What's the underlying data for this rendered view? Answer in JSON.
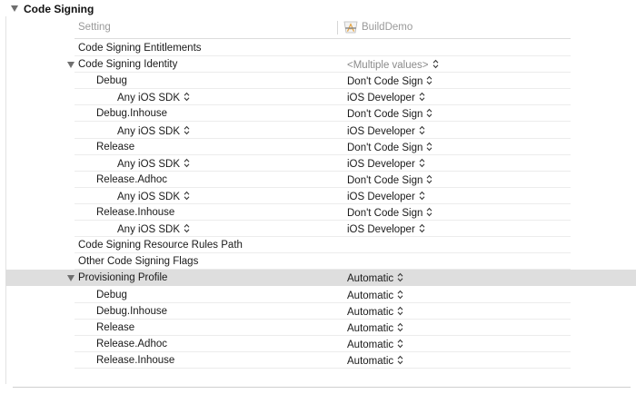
{
  "section": {
    "title": "Code Signing"
  },
  "columns": {
    "setting": "Setting",
    "target": "BuildDemo"
  },
  "rows": [
    {
      "label": "Code Signing Entitlements",
      "indent": 0,
      "expander": false,
      "value": "",
      "stepper": false,
      "muted": false,
      "selected": false
    },
    {
      "label": "Code Signing Identity",
      "indent": 0,
      "expander": true,
      "value": "<Multiple values>",
      "stepper": true,
      "muted": true,
      "selected": false
    },
    {
      "label": "Debug",
      "indent": 1,
      "expander": false,
      "value": "Don't Code Sign",
      "stepper": true,
      "muted": false,
      "selected": false
    },
    {
      "label": "Any iOS SDK",
      "indent": 2,
      "expander": false,
      "labelStepper": true,
      "value": "iOS Developer",
      "stepper": true,
      "muted": false,
      "selected": false
    },
    {
      "label": "Debug.Inhouse",
      "indent": 1,
      "expander": false,
      "value": "Don't Code Sign",
      "stepper": true,
      "muted": false,
      "selected": false
    },
    {
      "label": "Any iOS SDK",
      "indent": 2,
      "expander": false,
      "labelStepper": true,
      "value": "iOS Developer",
      "stepper": true,
      "muted": false,
      "selected": false
    },
    {
      "label": "Release",
      "indent": 1,
      "expander": false,
      "value": "Don't Code Sign",
      "stepper": true,
      "muted": false,
      "selected": false
    },
    {
      "label": "Any iOS SDK",
      "indent": 2,
      "expander": false,
      "labelStepper": true,
      "value": "iOS Developer",
      "stepper": true,
      "muted": false,
      "selected": false
    },
    {
      "label": "Release.Adhoc",
      "indent": 1,
      "expander": false,
      "value": "Don't Code Sign",
      "stepper": true,
      "muted": false,
      "selected": false
    },
    {
      "label": "Any iOS SDK",
      "indent": 2,
      "expander": false,
      "labelStepper": true,
      "value": "iOS Developer",
      "stepper": true,
      "muted": false,
      "selected": false
    },
    {
      "label": "Release.Inhouse",
      "indent": 1,
      "expander": false,
      "value": "Don't Code Sign",
      "stepper": true,
      "muted": false,
      "selected": false
    },
    {
      "label": "Any iOS SDK",
      "indent": 2,
      "expander": false,
      "labelStepper": true,
      "value": "iOS Developer",
      "stepper": true,
      "muted": false,
      "selected": false
    },
    {
      "label": "Code Signing Resource Rules Path",
      "indent": 0,
      "expander": false,
      "value": "",
      "stepper": false,
      "muted": false,
      "selected": false
    },
    {
      "label": "Other Code Signing Flags",
      "indent": 0,
      "expander": false,
      "value": "",
      "stepper": false,
      "muted": false,
      "selected": false
    },
    {
      "label": "Provisioning Profile",
      "indent": 0,
      "expander": true,
      "value": "Automatic",
      "stepper": true,
      "muted": false,
      "selected": true
    },
    {
      "label": "Debug",
      "indent": 1,
      "expander": false,
      "value": "Automatic",
      "stepper": true,
      "muted": false,
      "selected": false
    },
    {
      "label": "Debug.Inhouse",
      "indent": 1,
      "expander": false,
      "value": "Automatic",
      "stepper": true,
      "muted": false,
      "selected": false
    },
    {
      "label": "Release",
      "indent": 1,
      "expander": false,
      "value": "Automatic",
      "stepper": true,
      "muted": false,
      "selected": false
    },
    {
      "label": "Release.Adhoc",
      "indent": 1,
      "expander": false,
      "value": "Automatic",
      "stepper": true,
      "muted": false,
      "selected": false
    },
    {
      "label": "Release.Inhouse",
      "indent": 1,
      "expander": false,
      "value": "Automatic",
      "stepper": true,
      "muted": false,
      "selected": false
    }
  ],
  "icons": {
    "target": "xcode-app-target-icon",
    "expander": "disclosure-triangle-icon",
    "stepper": "up-down-stepper-icon"
  },
  "colors": {
    "selected_row": "#dedede",
    "muted_text": "#8a8a8a",
    "header_text": "#9a9a9a"
  }
}
